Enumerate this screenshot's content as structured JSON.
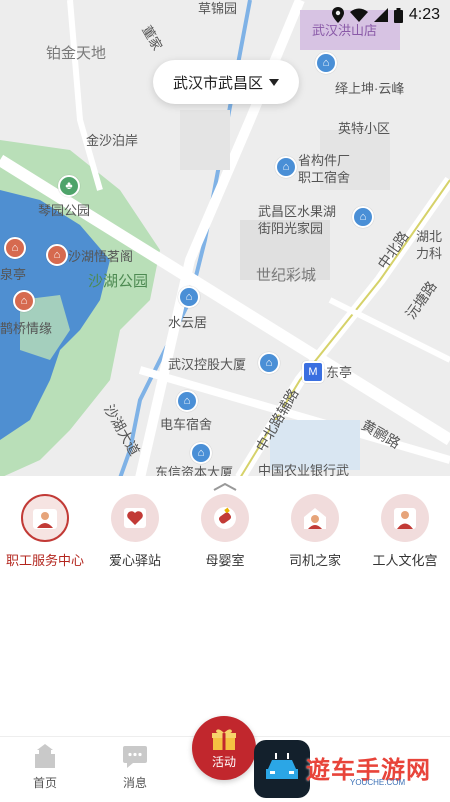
{
  "status": {
    "time": "4:23"
  },
  "map": {
    "district_selector": "武汉市武昌区",
    "labels": {
      "caoyuan_lu": "草锦园",
      "bojin_tiandi": "铂金天地",
      "dongjia": "董家",
      "wuhan_hongshan": "武汉洪山店",
      "yishang_yunfeng": "绎上坤·云峰",
      "yingte": "英特小区",
      "jinsha_boan": "金沙泊岸",
      "shenggou_dorm": "省构件厂\n职工宿舍",
      "qinyuan_park": "琴园公园",
      "shuiguo_hu": "武昌区水果湖\n街阳光家园",
      "hubei_li": "湖北\n力科",
      "shahu_pavilion": "沙湖悟茗阁",
      "shahu_park": "沙湖公园",
      "shijie_caicheng": "世纪彩城",
      "zhongbei_lu": "中北路",
      "yuantang_lu": "沅塘路",
      "quanting": "泉亭",
      "shuiyun_ju": "水云居",
      "queqiao": "鹊桥情缘",
      "wuhan_konggu": "武汉控股大厦",
      "dongting": "东亭",
      "shahu_dadao": "沙湖大道",
      "dianche_dorm": "电车宿舍",
      "zhongbei_lu2": "中北路辅路",
      "huangli_lu": "黄鹂路",
      "abc_bank": "中国农业银行武",
      "dongxin": "东信资本大厦"
    }
  },
  "categories": [
    {
      "label": "职工服务中心",
      "icon": "worker-icon",
      "active": true
    },
    {
      "label": "爱心驿站",
      "icon": "heart-icon",
      "active": false
    },
    {
      "label": "母婴室",
      "icon": "bottle-icon",
      "active": false
    },
    {
      "label": "司机之家",
      "icon": "driver-icon",
      "active": false
    },
    {
      "label": "工人文化宫",
      "icon": "culture-icon",
      "active": false
    }
  ],
  "tabs": {
    "home": "首页",
    "messages": "消息",
    "activity": "活动"
  },
  "watermark": {
    "text": "遊车手游网",
    "sub": "YOUCHE.COM"
  },
  "colors": {
    "accent": "#c1272d",
    "map_water": "#5b9bd5",
    "map_park": "#a8d5a8"
  }
}
